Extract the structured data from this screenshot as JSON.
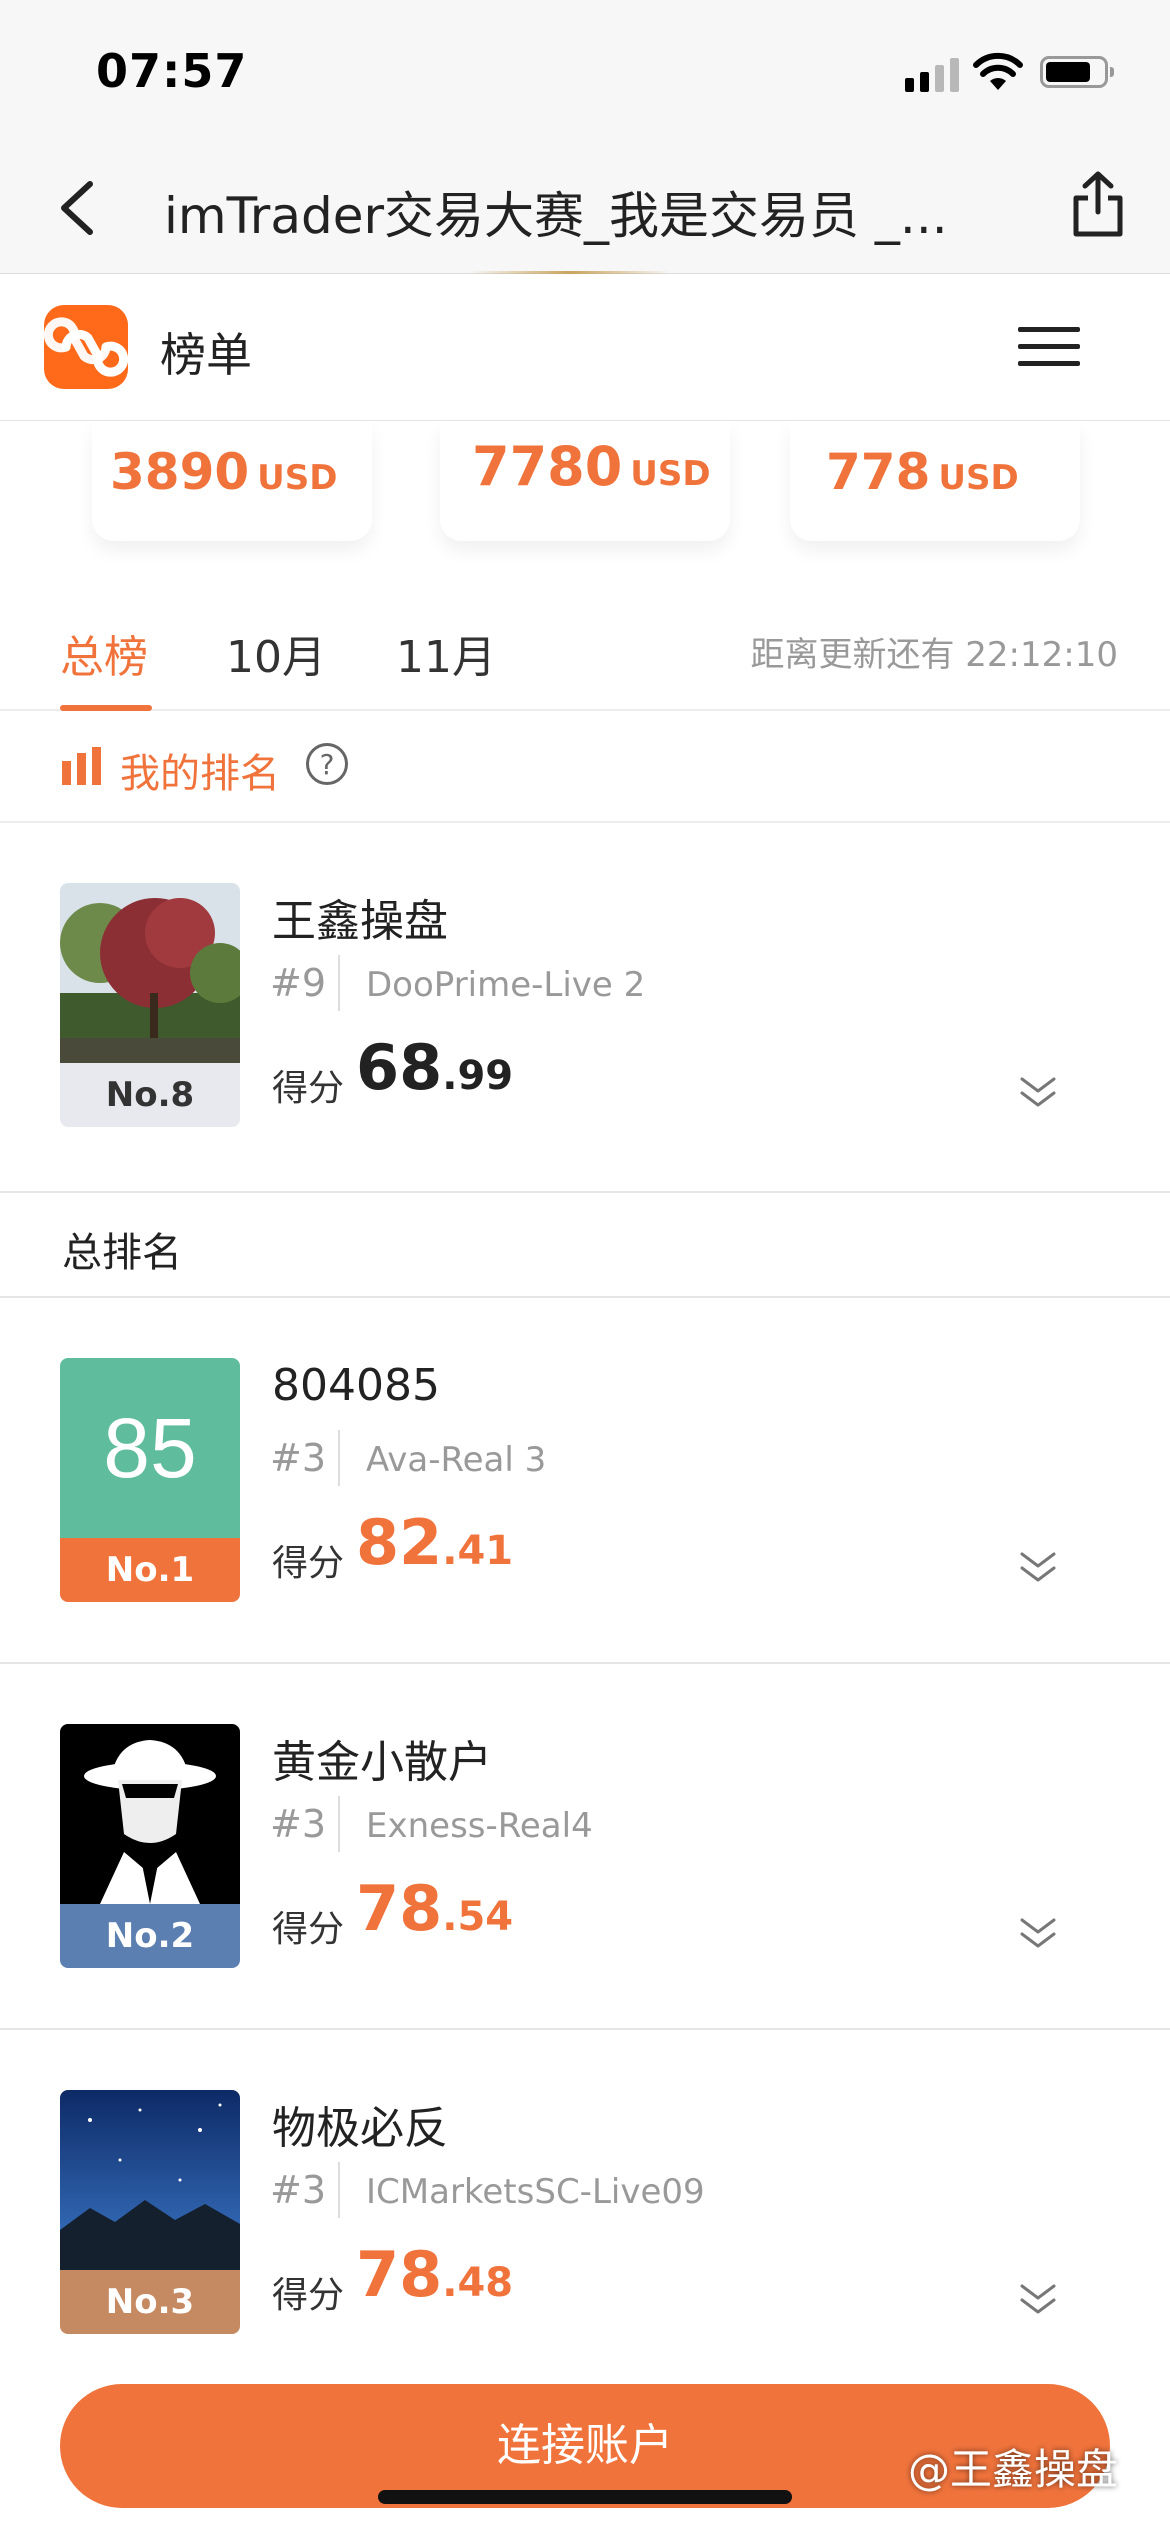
{
  "status_bar": {
    "time": "07:57"
  },
  "browser": {
    "title": "imTrader交易大赛_我是交易员 _..."
  },
  "app_header": {
    "title": "榜单"
  },
  "prizes": [
    {
      "amount": "3890",
      "unit": "USD"
    },
    {
      "amount": "7780",
      "unit": "USD"
    },
    {
      "amount": "778",
      "unit": "USD"
    }
  ],
  "tabs": [
    {
      "label": "总榜",
      "active": true
    },
    {
      "label": "10月",
      "active": false
    },
    {
      "label": "11月",
      "active": false
    }
  ],
  "countdown": "距离更新还有 22:12:10",
  "my_rank": {
    "label": "我的排名",
    "help_icon": "?",
    "entry": {
      "name": "王鑫操盘",
      "position": "#9",
      "account": "DooPrime-Live 2",
      "tag": "No.8",
      "score_label": "得分",
      "score_int": "68",
      "score_dec": ".99"
    }
  },
  "overall": {
    "title": "总排名",
    "entries": [
      {
        "name": "804085",
        "position": "#3",
        "account": "Ava-Real 3",
        "tag": "No.1",
        "avatar_text": "85",
        "score_label": "得分",
        "score_int": "82",
        "score_dec": ".41"
      },
      {
        "name": "黄金小散户",
        "position": "#3",
        "account": "Exness-Real4",
        "tag": "No.2",
        "score_label": "得分",
        "score_int": "78",
        "score_dec": ".54"
      },
      {
        "name": "物极必反",
        "position": "#3",
        "account": "ICMarketsSC-Live09",
        "tag": "No.3",
        "score_label": "得分",
        "score_int": "78",
        "score_dec": ".48"
      }
    ]
  },
  "cta": {
    "label": "连接账户"
  },
  "watermark": "@王鑫操盘",
  "colors": {
    "accent": "#f0733c",
    "no1_tag": "#f0733c",
    "no1_avatar": "#5fbd9e",
    "no2_tag": "#5b7fb0",
    "no3_tag": "#c58a62",
    "self_tag": "#e8e9ee"
  }
}
